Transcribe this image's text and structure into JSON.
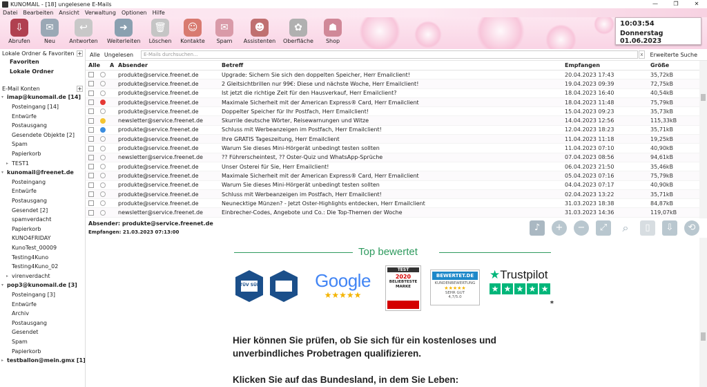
{
  "window": {
    "title": "KUNOMAIL - [18] ungelesene E-Mails",
    "controls": [
      "—",
      "❐",
      "✕"
    ]
  },
  "menu": [
    "Datei",
    "Bearbeiten",
    "Ansicht",
    "Verwaltung",
    "Optionen",
    "Hilfe"
  ],
  "toolbar": [
    {
      "label": "Abrufen",
      "icon": "fetch-icon",
      "color": "#b04050",
      "glyph": "⇩"
    },
    {
      "label": "Neu",
      "icon": "new-mail-icon",
      "color": "#9aa8b5",
      "glyph": "✉"
    },
    {
      "label": "Antworten",
      "icon": "reply-icon",
      "color": "#c8c8c8",
      "glyph": "↩"
    },
    {
      "label": "Weiterleiten",
      "icon": "forward-icon",
      "color": "#8aa0b0",
      "glyph": "➜"
    },
    {
      "label": "Löschen",
      "icon": "delete-icon",
      "color": "#c5c5c5",
      "glyph": "🗑"
    },
    {
      "label": "Kontakte",
      "icon": "contacts-icon",
      "color": "#d87a70",
      "glyph": "☺"
    },
    {
      "label": "Spam",
      "icon": "spam-icon",
      "color": "#d99aa8",
      "glyph": "✉"
    },
    {
      "label": "Assistenten",
      "icon": "assistant-icon",
      "color": "#c07070",
      "glyph": "☻"
    },
    {
      "label": "Oberfläche",
      "icon": "theme-icon",
      "color": "#b0b0b0",
      "glyph": "✿"
    },
    {
      "label": "Shop",
      "icon": "shop-icon",
      "color": "#d08898",
      "glyph": "☗"
    }
  ],
  "clock": {
    "time": "10:03:54",
    "date": "Donnerstag 01.06.2023"
  },
  "sidebar": {
    "local_header": "Lokale Ordner & Favoriten",
    "local_items": [
      {
        "label": "Favoriten",
        "bold": true,
        "indent": 14
      },
      {
        "label": "Lokale Ordner",
        "bold": true,
        "indent": 14
      }
    ],
    "accounts_header": "E-Mail Konten",
    "account_items": [
      {
        "label": "imap@kunomail.de [14]",
        "bold": true,
        "indent": 10,
        "arrow": "▾"
      },
      {
        "label": "Posteingang [14]",
        "bold": false,
        "indent": 17
      },
      {
        "label": "Entwürfe",
        "bold": false,
        "indent": 17
      },
      {
        "label": "Postausgang",
        "bold": false,
        "indent": 17
      },
      {
        "label": "Gesendete Objekte [2]",
        "bold": false,
        "indent": 17
      },
      {
        "label": "Spam",
        "bold": false,
        "indent": 17
      },
      {
        "label": "Papierkorb",
        "bold": false,
        "indent": 17
      },
      {
        "label": "TEST1",
        "bold": false,
        "indent": 17,
        "arrow": "▸"
      },
      {
        "label": "kunomail@freenet.de",
        "bold": true,
        "indent": 10,
        "arrow": "▾"
      },
      {
        "label": "Posteingang",
        "bold": false,
        "indent": 17
      },
      {
        "label": "Entwürfe",
        "bold": false,
        "indent": 17
      },
      {
        "label": "Postausgang",
        "bold": false,
        "indent": 17
      },
      {
        "label": "Gesendet [2]",
        "bold": false,
        "indent": 17
      },
      {
        "label": "spamverdacht",
        "bold": false,
        "indent": 17
      },
      {
        "label": "Papierkorb",
        "bold": false,
        "indent": 17
      },
      {
        "label": "KUNO4FRIDAY",
        "bold": false,
        "indent": 17
      },
      {
        "label": "KunoTest_00009",
        "bold": false,
        "indent": 17
      },
      {
        "label": "Testing4Kuno",
        "bold": false,
        "indent": 17
      },
      {
        "label": "Testing4Kuno_02",
        "bold": false,
        "indent": 17
      },
      {
        "label": "virenverdacht",
        "bold": false,
        "indent": 17,
        "arrow": "▸"
      },
      {
        "label": "pop3@kunomail.de [3]",
        "bold": true,
        "indent": 10,
        "arrow": "▾"
      },
      {
        "label": "Posteingang [3]",
        "bold": false,
        "indent": 17
      },
      {
        "label": "Entwürfe",
        "bold": false,
        "indent": 17
      },
      {
        "label": "Archiv",
        "bold": false,
        "indent": 17
      },
      {
        "label": "Postausgang",
        "bold": false,
        "indent": 17
      },
      {
        "label": "Gesendet",
        "bold": false,
        "indent": 17
      },
      {
        "label": "Spam",
        "bold": false,
        "indent": 17
      },
      {
        "label": "Papierkorb",
        "bold": false,
        "indent": 17
      },
      {
        "label": "testballon@mein.gmx [1]",
        "bold": true,
        "indent": 10,
        "arrow": "▸"
      }
    ]
  },
  "filters": {
    "all": "Alle",
    "unread": "Ungelesen",
    "search_placeholder": "E-Mails durchsuchen...",
    "clear": "x",
    "advanced": "Erweiterte Suche"
  },
  "columns": {
    "all": "Alle",
    "a": "A",
    "from": "Absender",
    "subject": "Betreff",
    "received": "Empfangen",
    "size": "Größe"
  },
  "emails": [
    {
      "from": "produkte@service.freenet.de",
      "subject": "Upgrade: Sichern Sie sich den doppelten Speicher, Herr Emailclient!",
      "date": "20.04.2023 17:43",
      "size": "35,72kB",
      "dot": ""
    },
    {
      "from": "produkte@service.freenet.de",
      "subject": "2 Gleitsichtbrillen nur 99€: Diese und nächste Woche, Herr Emailclient!",
      "date": "19.04.2023 09:39",
      "size": "72,75kB",
      "dot": ""
    },
    {
      "from": "produkte@service.freenet.de",
      "subject": "Ist jetzt die richtige Zeit für den Hausverkauf, Herr Emailclient?",
      "date": "18.04.2023 16:40",
      "size": "40,54kB",
      "dot": ""
    },
    {
      "from": "produkte@service.freenet.de",
      "subject": "Maximale Sicherheit mit der American Express® Card, Herr Emailclient",
      "date": "18.04.2023 11:48",
      "size": "75,79kB",
      "dot": "#e53935"
    },
    {
      "from": "produkte@service.freenet.de",
      "subject": "Doppelter Speicher für Ihr Postfach, Herr Emailclient!",
      "date": "15.04.2023 09:23",
      "size": "35,73kB",
      "dot": ""
    },
    {
      "from": "newsletter@service.freenet.de",
      "subject": "Skurrile deutsche Wörter, Reisewarnungen und Witze",
      "date": "14.04.2023 12:56",
      "size": "115,33kB",
      "dot": "#f4c430"
    },
    {
      "from": "produkte@service.freenet.de",
      "subject": "Schluss mit Werbeanzeigen im Postfach, Herr Emailclient!",
      "date": "12.04.2023 18:23",
      "size": "35,71kB",
      "dot": "#3b8de0"
    },
    {
      "from": "produkte@service.freenet.de",
      "subject": "Ihre GRATIS Tageszeitung, Herr Emailclient",
      "date": "11.04.2023 11:18",
      "size": "19,25kB",
      "dot": ""
    },
    {
      "from": "produkte@service.freenet.de",
      "subject": "Warum Sie dieses Mini-Hörgerät unbedingt testen sollten",
      "date": "11.04.2023 07:10",
      "size": "40,90kB",
      "dot": ""
    },
    {
      "from": "newsletter@service.freenet.de",
      "subject": "?? Führerscheintest,  ?? Oster-Quiz und WhatsApp-Sprüche",
      "date": "07.04.2023 08:56",
      "size": "94,61kB",
      "dot": ""
    },
    {
      "from": "produkte@service.freenet.de",
      "subject": "Unser Osterei für Sie, Herr Emailclient!",
      "date": "06.04.2023 21:50",
      "size": "35,46kB",
      "dot": ""
    },
    {
      "from": "produkte@service.freenet.de",
      "subject": "Maximale Sicherheit mit der American Express® Card, Herr Emailclient",
      "date": "05.04.2023 07:16",
      "size": "75,79kB",
      "dot": ""
    },
    {
      "from": "produkte@service.freenet.de",
      "subject": "Warum Sie dieses Mini-Hörgerät unbedingt testen sollten",
      "date": "04.04.2023 07:17",
      "size": "40,90kB",
      "dot": ""
    },
    {
      "from": "produkte@service.freenet.de",
      "subject": "Schluss mit Werbeanzeigen im Postfach, Herr Emailclient!",
      "date": "02.04.2023 13:22",
      "size": "35,71kB",
      "dot": ""
    },
    {
      "from": "produkte@service.freenet.de",
      "subject": "Neunecktige Münzen? - Jetzt Oster-Highlights entdecken, Herr Emailclient",
      "date": "31.03.2023 18:38",
      "size": "84,87kB",
      "dot": ""
    },
    {
      "from": "newsletter@service.freenet.de",
      "subject": "Einbrecher-Codes, Angebote und Co.: Die Top-Themen der Woche",
      "date": "31.03.2023 14:36",
      "size": "119,07kB",
      "dot": ""
    }
  ],
  "preview": {
    "from_line": "Absender: produkte@service.freenet.de",
    "received_line": "Empfangen: 21.03.2023 07:13:00",
    "icons": [
      "speaker-icon",
      "zoom-in-icon",
      "zoom-out-icon",
      "fit-icon",
      "search-icon",
      "delete-icon",
      "save-icon",
      "link-icon"
    ],
    "top_heading": "Top bewertet",
    "badges": {
      "tuv": "TÜV SÜD",
      "google": "Google",
      "google_stars": "★★★★★",
      "test_top": "TEST",
      "test_year": "2020",
      "test_label": "BELIEBTESTE MARKE",
      "bewertet": "BEWERTET.DE",
      "bewertet_sub": "KUNDENBEWERTUNG",
      "bewertet_grade": "SEHR GUT",
      "bewertet_score": "4,7/5.0",
      "trustpilot": "Trustpilot",
      "asterisk": "*"
    },
    "body1a": "Hier können Sie prüfen, ob Sie sich für ein kostenloses und",
    "body1b": "unverbindliches Probetragen qualifizieren.",
    "body2": "Klicken Sie auf das Bundesland, in dem Sie Leben:"
  }
}
